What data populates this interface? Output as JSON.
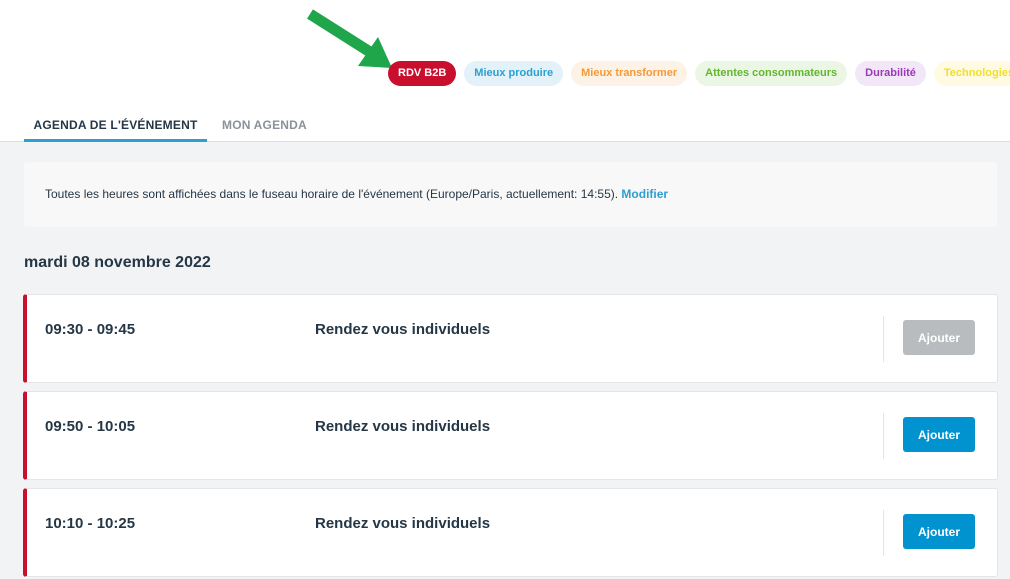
{
  "colors": {
    "arrow": "#1fa64a",
    "accent": "#0093d0",
    "rdv": "#c8102e",
    "disabled": "#b8bcbf"
  },
  "tags": [
    {
      "label": "RDV B2B",
      "name": "tag-rdv-b2b"
    },
    {
      "label": "Mieux produire",
      "name": "tag-mieux-produire"
    },
    {
      "label": "Mieux transformer",
      "name": "tag-mieux-transformer"
    },
    {
      "label": "Attentes consommateurs",
      "name": "tag-attentes-consommateurs"
    },
    {
      "label": "Durabilité",
      "name": "tag-durabilite"
    },
    {
      "label": "Technologies",
      "name": "tag-technologies"
    }
  ],
  "tabs": [
    {
      "label": "AGENDA DE L'ÉVÉNEMENT",
      "active": true
    },
    {
      "label": "MON AGENDA",
      "active": false
    }
  ],
  "timezone": {
    "text": "Toutes les heures sont affichées dans le fuseau horaire de l'événement (Europe/Paris, actuellement: 14:55). ",
    "modify_label": "Modifier"
  },
  "date_heading": "mardi 08 novembre 2022",
  "sessions": [
    {
      "time": "09:30 - 09:45",
      "title": "Rendez vous individuels",
      "button_label": "Ajouter",
      "button_enabled": false
    },
    {
      "time": "09:50 - 10:05",
      "title": "Rendez vous individuels",
      "button_label": "Ajouter",
      "button_enabled": true
    },
    {
      "time": "10:10 - 10:25",
      "title": "Rendez vous individuels",
      "button_label": "Ajouter",
      "button_enabled": true
    }
  ]
}
